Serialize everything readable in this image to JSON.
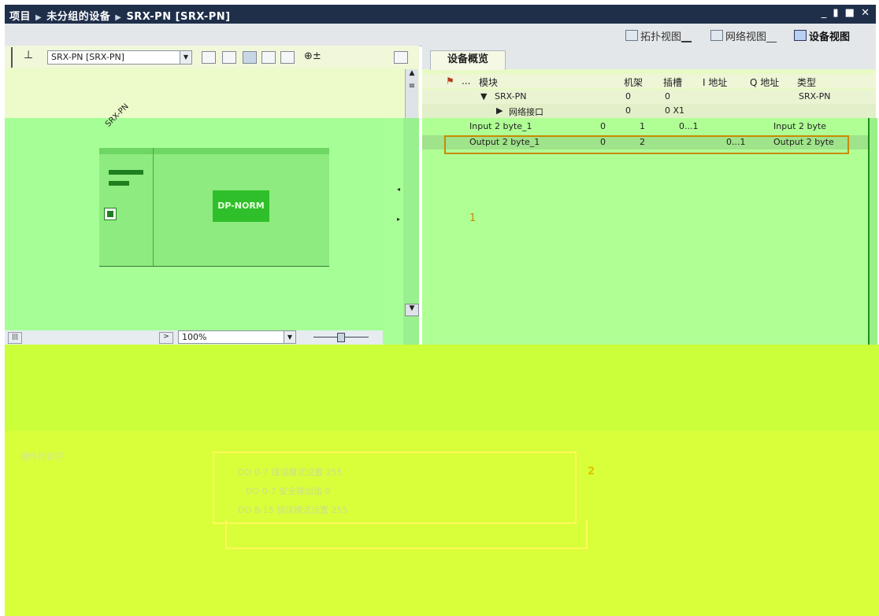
{
  "titlebar": {
    "crumbs": [
      "项目",
      "未分组的设备",
      "SRX-PN [SRX-PN]"
    ],
    "window_controls": "_ ▮ ■ ✕"
  },
  "views": {
    "topology": "拓扑视图",
    "network": "网络视图",
    "device": "设备视图"
  },
  "device_view": {
    "device_selector": "SRX-PN [SRX-PN]",
    "device_label": "SRX-PN",
    "module_label": "DP-NORM",
    "zoom": "100%"
  },
  "overview": {
    "tab": "设备概览",
    "columns": {
      "ellipsis": "...",
      "module": "模块",
      "rack": "机架",
      "slot": "插槽",
      "i_addr": "I 地址",
      "q_addr": "Q 地址",
      "type": "类型"
    },
    "rows": [
      {
        "module": "SRX-PN",
        "rack": "0",
        "slot": "0",
        "i": "",
        "q": "",
        "type": "SRX-PN"
      },
      {
        "module": "网络接口",
        "rack": "0",
        "slot": "0 X1",
        "i": "",
        "q": "",
        "type": ""
      },
      {
        "module": "Input 2 byte_1",
        "rack": "0",
        "slot": "1",
        "i": "0...1",
        "q": "",
        "type": "Input 2 byte"
      },
      {
        "module": "Output 2 byte_1",
        "rack": "0",
        "slot": "2",
        "i": "",
        "q": "0...1",
        "type": "Output 2 byte"
      }
    ],
    "callout": "1"
  },
  "properties": {
    "hw_id_label": "硬件标识符",
    "lines": [
      "DO 0-7 错误模式设置 255",
      "DO 0-7 安全输出值 0",
      "DO 8-15 错误模式设置 255"
    ],
    "callout": "2"
  },
  "colors": {
    "titlebar": "#1f2f4a",
    "canvas_green": "#a6ff96",
    "bottom_yellow": "#d9ff3a",
    "highlight_orange": "#c98a00"
  }
}
